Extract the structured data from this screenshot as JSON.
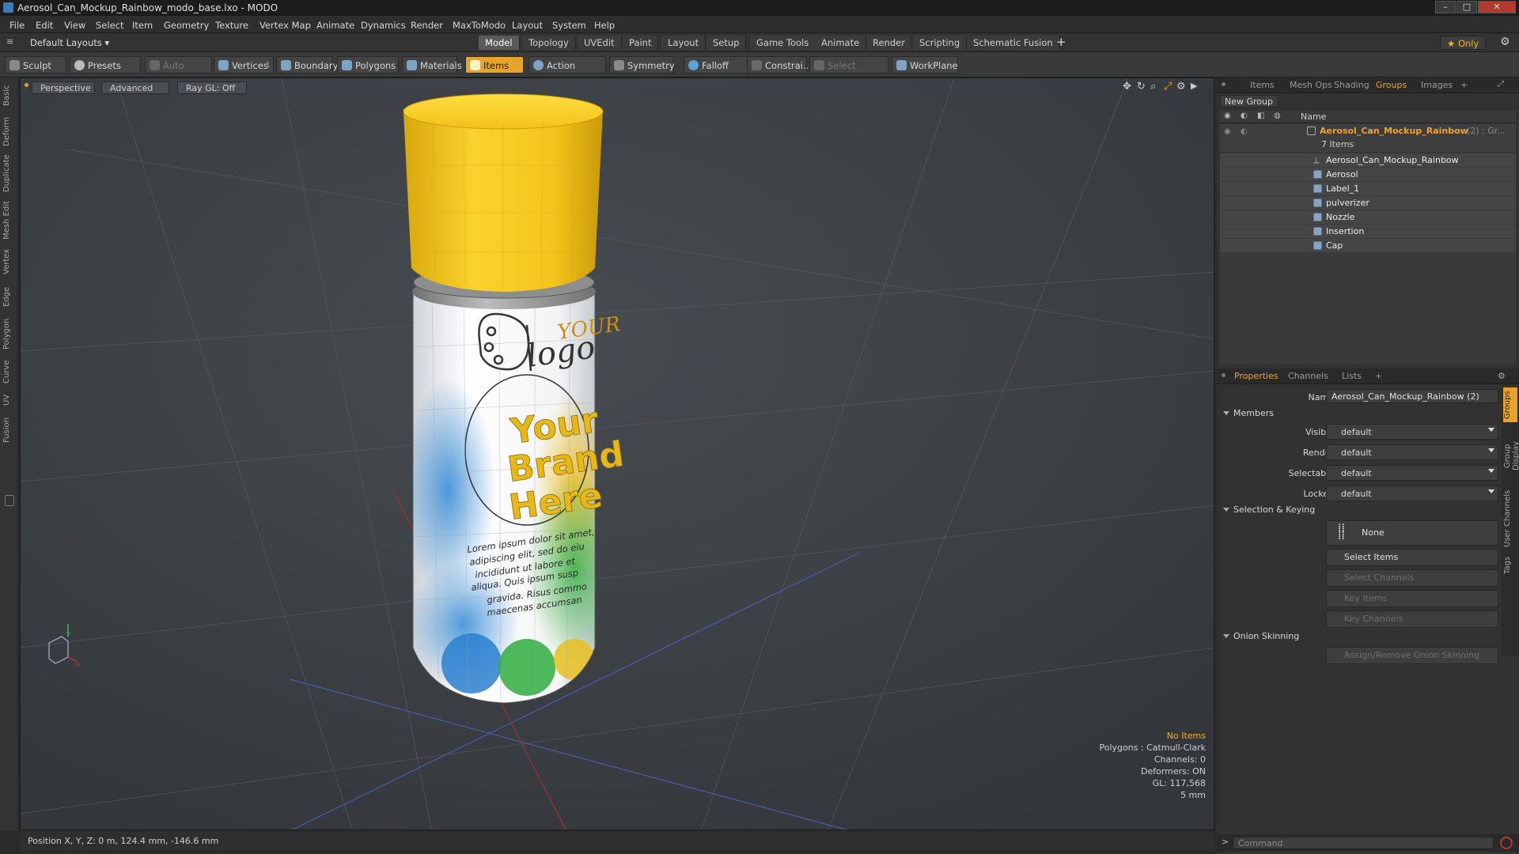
{
  "window": {
    "title": "Aerosol_Can_Mockup_Rainbow_modo_base.lxo - MODO",
    "minimize": "–",
    "maximize": "□",
    "close": "✕"
  },
  "menu": [
    "File",
    "Edit",
    "View",
    "Select",
    "Item",
    "Geometry",
    "Texture",
    "Vertex Map",
    "Animate",
    "Dynamics",
    "Render",
    "MaxToModo",
    "Layout",
    "System",
    "Help"
  ],
  "layoutbar": {
    "layouts_label": "Default Layouts ▾",
    "tabs": [
      "Model",
      "Topology",
      "UVEdit",
      "Paint",
      "Layout",
      "Setup",
      "Game Tools",
      "Animate",
      "Render",
      "Scripting",
      "Schematic Fusion"
    ],
    "active_tab": "Model",
    "add": "+",
    "only_label": "★  Only",
    "gear": "⚙"
  },
  "toolbar": {
    "sculpt": "Sculpt",
    "presets": "Presets",
    "auto_select": "Auto Select",
    "vertices": "Vertices",
    "vertices_count": "1",
    "boundary": "Boundary",
    "polygons": "Polygons",
    "materials": "Materials",
    "items": "Items",
    "action_center": "Action Center",
    "symmetry": "Symmetry",
    "falloff": "Falloff",
    "constraints": "Constrai...",
    "select_through": "Select Through",
    "workplane": "WorkPlane"
  },
  "left_tabs": [
    "Basic",
    "Deform",
    "Duplicate",
    "Mesh Edit",
    "Vertex",
    "Edge",
    "Polygon",
    "Curve",
    "UV",
    "Fusion"
  ],
  "viewport": {
    "view_mode": "Perspective",
    "shading": "Advanced",
    "raygl": "Ray GL: Off",
    "info": {
      "selection": "No Items",
      "polygons": "Polygons : Catmull-Clark",
      "channels": "Channels: 0",
      "deformers": "Deformers: ON",
      "gl": "GL: 117,568",
      "scale": "5 mm"
    },
    "label": {
      "logo_text_a": "YOUR",
      "logo_text_b": "logo",
      "brand_1": "Your",
      "brand_2": "Brand",
      "brand_3": "Here",
      "lorem_1": "Lorem ipsum dolor sit amet,",
      "lorem_2": "adipiscing elit, sed do eiu",
      "lorem_3": "incididunt ut labore et",
      "lorem_4": "aliqua. Quis ipsum susp",
      "lorem_5": "gravida. Risus commo",
      "lorem_6": "maecenas accumsan"
    },
    "colors": {
      "cap": "#f2c21a",
      "background": "#3c4044"
    }
  },
  "status": {
    "position": "Position X, Y, Z:  0 m, 124.4 mm, -146.6 mm"
  },
  "groups_panel": {
    "tabs": [
      "Items",
      "Mesh Ops",
      "Shading",
      "Groups",
      "Images"
    ],
    "active_tab": "Groups",
    "add": "+",
    "new_group": "New Group",
    "column_name": "Name",
    "group_name": "Aerosol_Can_Mockup_Rainbow",
    "group_suffix": "(2) : Gr...",
    "items_count": "7 Items",
    "items": [
      "Aerosol_Can_Mockup_Rainbow",
      "Aerosol",
      "Label_1",
      "pulverizer",
      "Nozzle",
      "Insertion",
      "Cap"
    ]
  },
  "properties": {
    "tabs": [
      "Properties",
      "Channels",
      "Lists"
    ],
    "active_tab": "Properties",
    "add": "+",
    "name_label": "Name",
    "name_value": "Aerosol_Can_Mockup_Rainbow (2)",
    "members_section": "Members",
    "fields": [
      {
        "label": "Visible",
        "value": "default"
      },
      {
        "label": "Render",
        "value": "default"
      },
      {
        "label": "Selectable",
        "value": "default"
      },
      {
        "label": "Locked",
        "value": "default"
      }
    ],
    "selection_section": "Selection & Keying",
    "none_label": "None",
    "select_items": "Select Items",
    "select_channels": "Select Channels",
    "key_items": "Key Items",
    "key_channels": "Key Channels",
    "onion_section": "Onion Skinning",
    "onion_button": "Assign/Remove Onion Skinning",
    "side_tabs": [
      "Groups",
      "Group Display",
      "User Channels",
      "Tags"
    ]
  },
  "command": {
    "prompt": ">",
    "placeholder": "Command"
  }
}
